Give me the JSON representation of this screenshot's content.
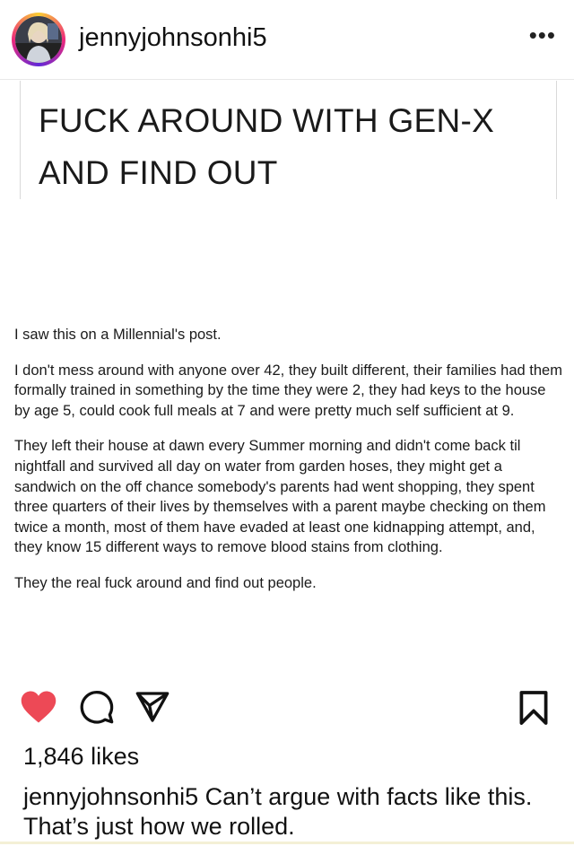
{
  "post": {
    "username": "jennyjohnsonhi5",
    "more_label": "•••",
    "headline_line1": "FUCK AROUND WITH GEN-X",
    "headline_line2": "AND FIND OUT",
    "paragraphs": [
      "I saw this on a Millennial's post.",
      "I don't mess around with anyone over 42, they built different, their families had them formally trained in something by the time they were 2, they had keys to the house by age 5, could cook full meals at 7 and were pretty much self sufficient at 9.",
      "They left their house at dawn every Summer morning and didn't come back til nightfall and survived all day on water from garden hoses, they might get a sandwich on the off chance somebody's parents had went shopping, they spent three quarters of their lives by themselves with a parent maybe checking on them twice a month, most of them have evaded at least one kidnapping attempt, and, they know 15 different ways to remove blood stains from clothing.",
      "They the real fuck around and find out people."
    ],
    "likes": "1,846 likes",
    "caption_user": "jennyjohnsonhi5",
    "caption_text": " Can’t argue with facts like this. That’s just how we rolled."
  },
  "icons": {
    "like": "heart-icon",
    "comment": "comment-icon",
    "share": "send-icon",
    "save": "bookmark-icon"
  },
  "colors": {
    "like_active": "#ed4956",
    "avatar_ring": [
      "#f9ce34",
      "#ee2a7b",
      "#6228d7"
    ]
  }
}
